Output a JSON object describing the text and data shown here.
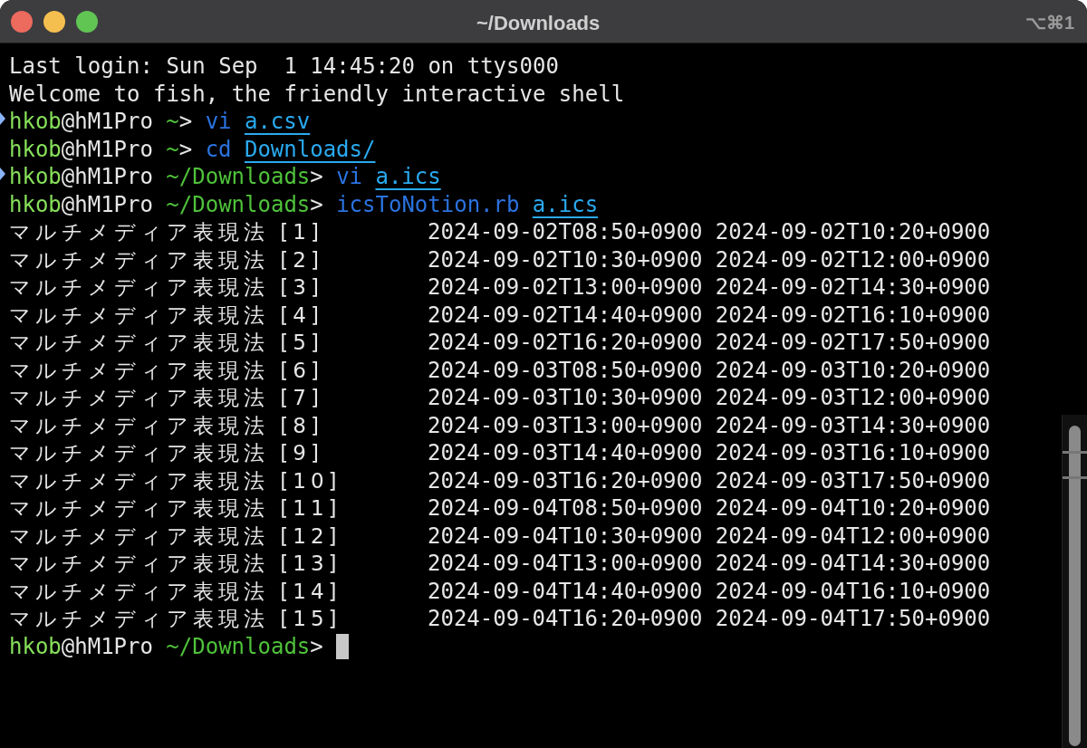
{
  "window": {
    "title": "~/Downloads",
    "shortcut": "⌥⌘1"
  },
  "lines": [
    {
      "kind": "text",
      "text": "Last login: Sun Sep  1 14:45:20 on ttys000"
    },
    {
      "kind": "text",
      "text": "Welcome to fish, the friendly interactive shell"
    },
    {
      "kind": "prompt",
      "mark": true,
      "user": "hkob",
      "host": "@hM1Pro",
      "cwd": "~",
      "sign": ">",
      "command": "vi",
      "argument": "a.csv"
    },
    {
      "kind": "prompt",
      "mark": false,
      "user": "hkob",
      "host": "@hM1Pro",
      "cwd": "~",
      "sign": ">",
      "command": "cd",
      "argument": "Downloads/"
    },
    {
      "kind": "prompt",
      "mark": true,
      "user": "hkob",
      "host": "@hM1Pro",
      "cwd": "~/Downloads",
      "sign": ">",
      "command": "vi",
      "argument": "a.ics"
    },
    {
      "kind": "prompt",
      "mark": false,
      "user": "hkob",
      "host": "@hM1Pro",
      "cwd": "~/Downloads",
      "sign": ">",
      "command": "icsToNotion.rb",
      "argument": "a.ics"
    },
    {
      "kind": "row",
      "name": "マルチメディア表現法 [1]",
      "start": "2024-09-02T08:50+0900",
      "end": "2024-09-02T10:20+0900"
    },
    {
      "kind": "row",
      "name": "マルチメディア表現法 [2]",
      "start": "2024-09-02T10:30+0900",
      "end": "2024-09-02T12:00+0900"
    },
    {
      "kind": "row",
      "name": "マルチメディア表現法 [3]",
      "start": "2024-09-02T13:00+0900",
      "end": "2024-09-02T14:30+0900"
    },
    {
      "kind": "row",
      "name": "マルチメディア表現法 [4]",
      "start": "2024-09-02T14:40+0900",
      "end": "2024-09-02T16:10+0900"
    },
    {
      "kind": "row",
      "name": "マルチメディア表現法 [5]",
      "start": "2024-09-02T16:20+0900",
      "end": "2024-09-02T17:50+0900"
    },
    {
      "kind": "row",
      "name": "マルチメディア表現法 [6]",
      "start": "2024-09-03T08:50+0900",
      "end": "2024-09-03T10:20+0900"
    },
    {
      "kind": "row",
      "name": "マルチメディア表現法 [7]",
      "start": "2024-09-03T10:30+0900",
      "end": "2024-09-03T12:00+0900"
    },
    {
      "kind": "row",
      "name": "マルチメディア表現法 [8]",
      "start": "2024-09-03T13:00+0900",
      "end": "2024-09-03T14:30+0900"
    },
    {
      "kind": "row",
      "name": "マルチメディア表現法 [9]",
      "start": "2024-09-03T14:40+0900",
      "end": "2024-09-03T16:10+0900"
    },
    {
      "kind": "row",
      "name": "マルチメディア表現法 [10]",
      "start": "2024-09-03T16:20+0900",
      "end": "2024-09-03T17:50+0900"
    },
    {
      "kind": "row",
      "name": "マルチメディア表現法 [11]",
      "start": "2024-09-04T08:50+0900",
      "end": "2024-09-04T10:20+0900"
    },
    {
      "kind": "row",
      "name": "マルチメディア表現法 [12]",
      "start": "2024-09-04T10:30+0900",
      "end": "2024-09-04T12:00+0900"
    },
    {
      "kind": "row",
      "name": "マルチメディア表現法 [13]",
      "start": "2024-09-04T13:00+0900",
      "end": "2024-09-04T14:30+0900"
    },
    {
      "kind": "row",
      "name": "マルチメディア表現法 [14]",
      "start": "2024-09-04T14:40+0900",
      "end": "2024-09-04T16:10+0900"
    },
    {
      "kind": "row",
      "name": "マルチメディア表現法 [15]",
      "start": "2024-09-04T16:20+0900",
      "end": "2024-09-04T17:50+0900"
    },
    {
      "kind": "prompt",
      "mark": false,
      "cursor": true,
      "user": "hkob",
      "host": "@hM1Pro",
      "cwd": "~/Downloads",
      "sign": ">"
    }
  ]
}
